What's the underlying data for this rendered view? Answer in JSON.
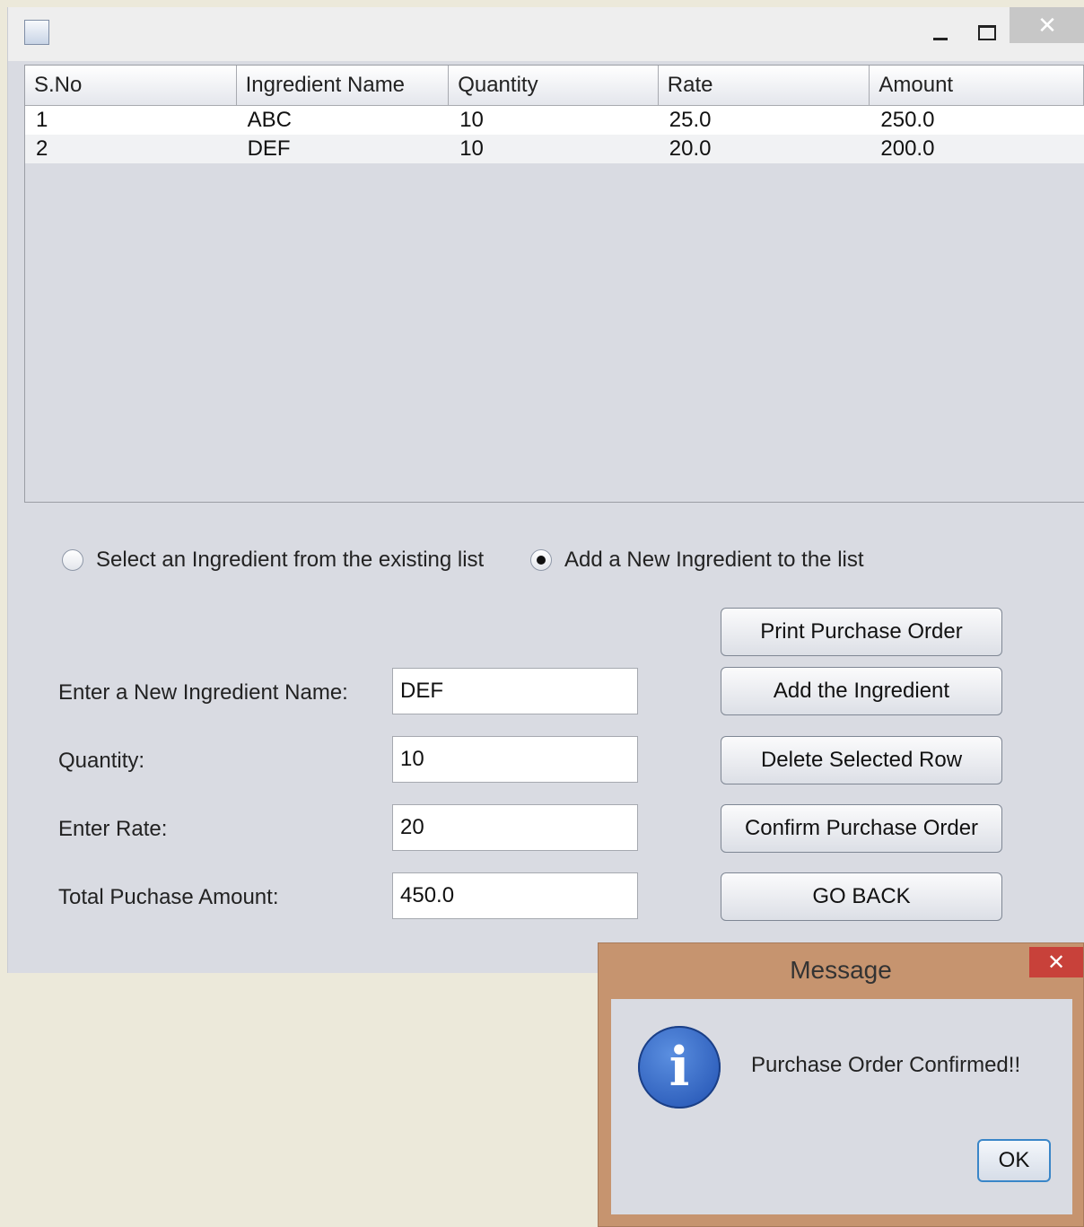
{
  "window": {
    "minimize_symbol": "",
    "close_symbol": "✕"
  },
  "table": {
    "columns": [
      "S.No",
      "Ingredient Name",
      "Quantity",
      "Rate",
      "Amount"
    ],
    "rows": [
      [
        "1",
        "ABC",
        "10",
        "25.0",
        "250.0"
      ],
      [
        "2",
        "DEF",
        "10",
        "20.0",
        "200.0"
      ]
    ]
  },
  "options": {
    "existing_label": "Select an Ingredient from the existing list",
    "new_label": "Add a New Ingredient to the list",
    "selected": "new"
  },
  "form": {
    "name_label": "Enter a New Ingredient Name:",
    "name_value": "DEF",
    "quantity_label": "Quantity:",
    "quantity_value": "10",
    "rate_label": "Enter Rate:",
    "rate_value": "20",
    "total_label": "Total Puchase Amount:",
    "total_value": "450.0"
  },
  "buttons": {
    "print": "Print Purchase Order",
    "add": "Add the Ingredient",
    "delete": "Delete Selected Row",
    "confirm": "Confirm Purchase Order",
    "back": "GO BACK"
  },
  "dialog": {
    "title": "Message",
    "close_symbol": "✕",
    "icon": "i",
    "message": "Purchase Order Confirmed!!",
    "ok": "OK"
  },
  "colors": {
    "dialog_frame": "#c6946f",
    "dialog_close": "#c8413a",
    "info_icon": "#2a5fc0"
  }
}
